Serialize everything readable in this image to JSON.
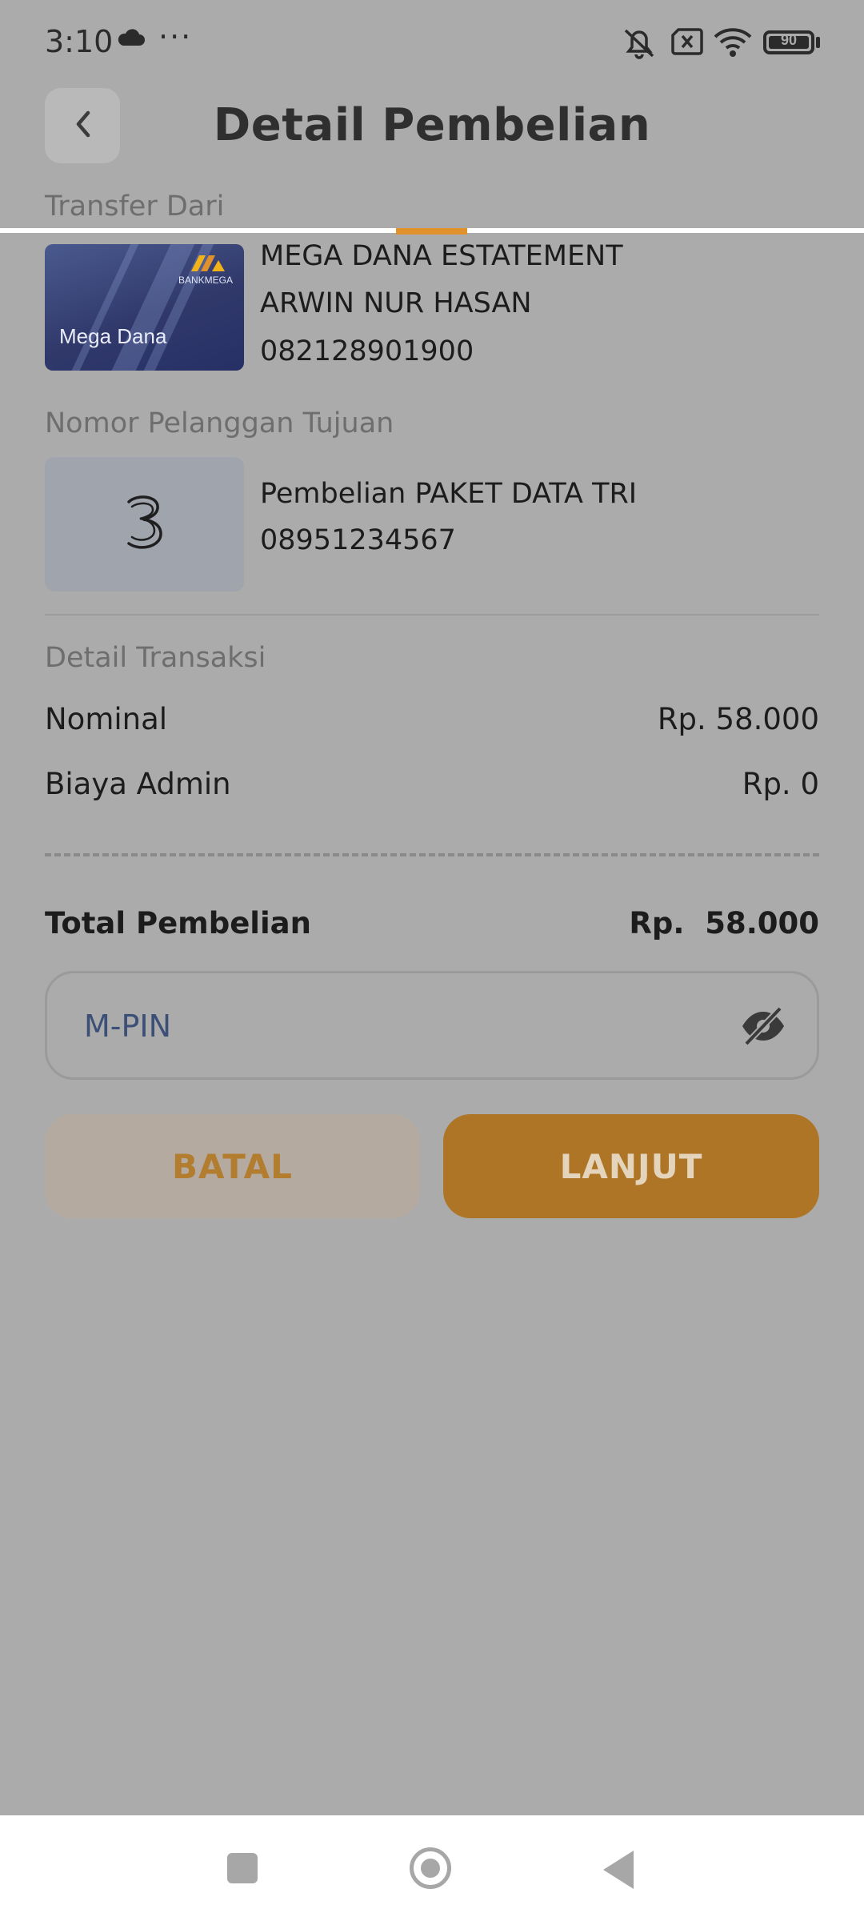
{
  "status_bar": {
    "time": "3:10",
    "more": "···",
    "battery": "90",
    "icons": [
      "cloud-icon",
      "mute-icon",
      "no-sim-icon",
      "wifi-icon",
      "battery-icon"
    ]
  },
  "header": {
    "title": "Detail Pembelian",
    "back_icon": "chevron-left-icon"
  },
  "progress": {
    "value": 0.5
  },
  "source": {
    "label": "Transfer Dari",
    "card_name": "Mega Dana",
    "card_bank": "BANKMEGA",
    "account_name": "MEGA DANA ESTATEMENT",
    "holder": "ARWIN NUR HASAN",
    "number": "082128901900"
  },
  "target": {
    "label": "Nomor Pelanggan Tujuan",
    "operator_logo": "3",
    "product": "Pembelian PAKET DATA TRI",
    "number": "08951234567"
  },
  "details": {
    "label": "Detail Transaksi",
    "rows": [
      {
        "label": "Nominal",
        "value": "Rp. 58.000"
      },
      {
        "label": "Biaya Admin",
        "value": "Rp. 0"
      }
    ],
    "total_label": "Total Pembelian",
    "total_value": "Rp.  58.000"
  },
  "pin": {
    "placeholder": "M-PIN",
    "toggle_icon": "eye-off-icon"
  },
  "actions": {
    "cancel": "BATAL",
    "next": "LANJUT"
  },
  "colors": {
    "accent": "#e0912b",
    "overlay": "#ababab"
  }
}
